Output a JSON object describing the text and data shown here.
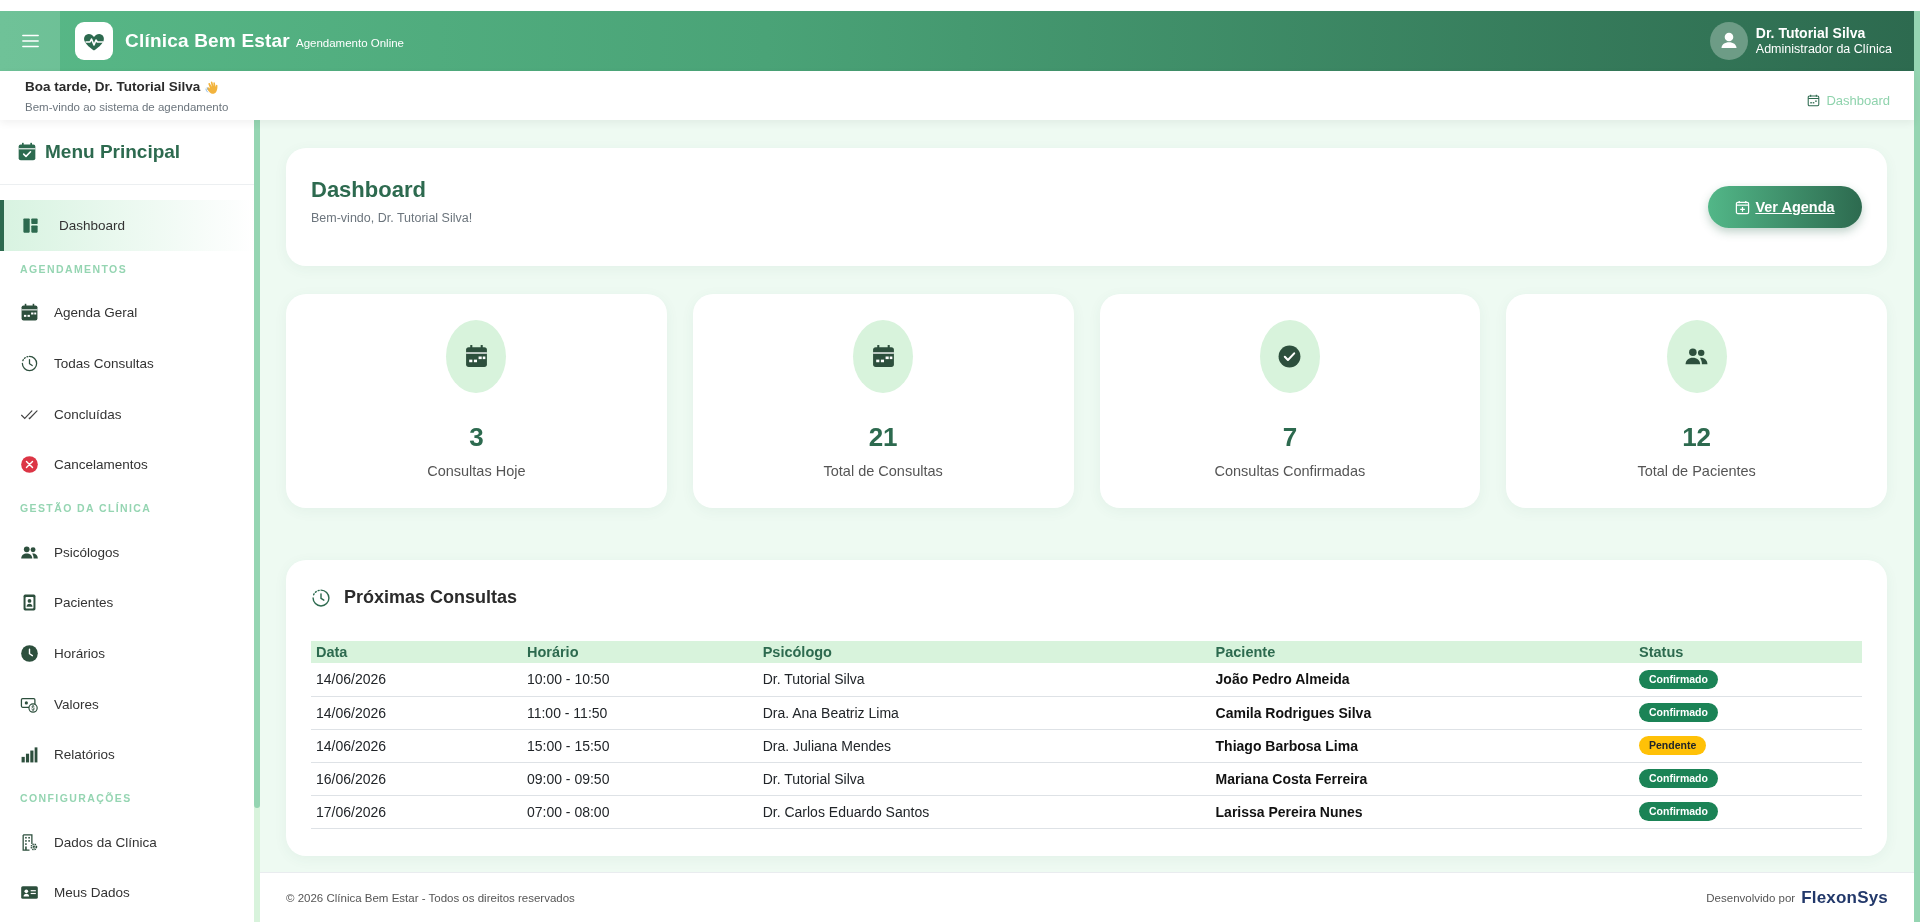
{
  "topbar": {
    "title": "Clínica Bem Estar",
    "subtitle": "Agendamento Online",
    "user": {
      "name": "Dr. Tutorial Silva",
      "role": "Administrador da Clínica"
    }
  },
  "greeting": {
    "title": "Boa tarde, Dr. Tutorial Silva",
    "subtitle": "Bem-vindo ao sistema de agendamento",
    "breadcrumb": "Dashboard"
  },
  "sidebar": {
    "title": "Menu Principal",
    "items": [
      {
        "label": "Dashboard",
        "selected": true
      }
    ],
    "sections": [
      {
        "heading": "AGENDAMENTOS",
        "items": [
          {
            "label": "Agenda Geral",
            "selected": false
          },
          {
            "label": "Todas Consultas",
            "selected": false
          },
          {
            "label": "Concluídas",
            "selected": false
          },
          {
            "label": "Cancelamentos",
            "selected": false
          }
        ]
      },
      {
        "heading": "GESTÃO DA CLÍNICA",
        "items": [
          {
            "label": "Psicólogos",
            "selected": false
          },
          {
            "label": "Pacientes",
            "selected": false
          },
          {
            "label": "Horários",
            "selected": false
          },
          {
            "label": "Valores",
            "selected": false
          },
          {
            "label": "Relatórios",
            "selected": false
          }
        ]
      },
      {
        "heading": "CONFIGURAÇÕES",
        "items": [
          {
            "label": "Dados da Clínica",
            "selected": false
          },
          {
            "label": "Meus Dados",
            "selected": false
          }
        ]
      }
    ]
  },
  "page_header": {
    "title": "Dashboard",
    "subtitle": "Bem-vindo, Dr. Tutorial Silva!",
    "button": "Ver Agenda"
  },
  "stats": [
    {
      "value": "3",
      "label": "Consultas Hoje"
    },
    {
      "value": "21",
      "label": "Total de Consultas"
    },
    {
      "value": "7",
      "label": "Consultas Confirmadas"
    },
    {
      "value": "12",
      "label": "Total de Pacientes"
    }
  ],
  "appointments": {
    "title": "Próximas Consultas",
    "columns": [
      "Data",
      "Horário",
      "Psicólogo",
      "Paciente",
      "Status"
    ],
    "rows": [
      {
        "date": "14/06/2026",
        "time": "10:00 - 10:50",
        "psychologist": "Dr. Tutorial Silva",
        "patient": "João Pedro Almeida",
        "status": {
          "label": "Confirmado",
          "color": "#1b8356"
        }
      },
      {
        "date": "14/06/2026",
        "time": "11:00 - 11:50",
        "psychologist": "Dra. Ana Beatriz Lima",
        "patient": "Camila Rodrigues Silva",
        "status": {
          "label": "Confirmado",
          "color": "#1b8356"
        }
      },
      {
        "date": "14/06/2026",
        "time": "15:00 - 15:50",
        "psychologist": "Dra. Juliana Mendes",
        "patient": "Thiago Barbosa Lima",
        "status": {
          "label": "Pendente",
          "color": "#ffc107"
        }
      },
      {
        "date": "16/06/2026",
        "time": "09:00 - 09:50",
        "psychologist": "Dr. Tutorial Silva",
        "patient": "Mariana Costa Ferreira",
        "status": {
          "label": "Confirmado",
          "color": "#1b8356"
        }
      },
      {
        "date": "17/06/2026",
        "time": "07:00 - 08:00",
        "psychologist": "Dr. Carlos Eduardo Santos",
        "patient": "Larissa Pereira Nunes",
        "status": {
          "label": "Confirmado",
          "color": "#1b8356"
        }
      }
    ]
  },
  "footer": {
    "copyright": "© 2026 Clínica Bem Estar - Todos os direitos reservados",
    "credit": "Desenvolvido por",
    "brand": "FlexonSys"
  }
}
